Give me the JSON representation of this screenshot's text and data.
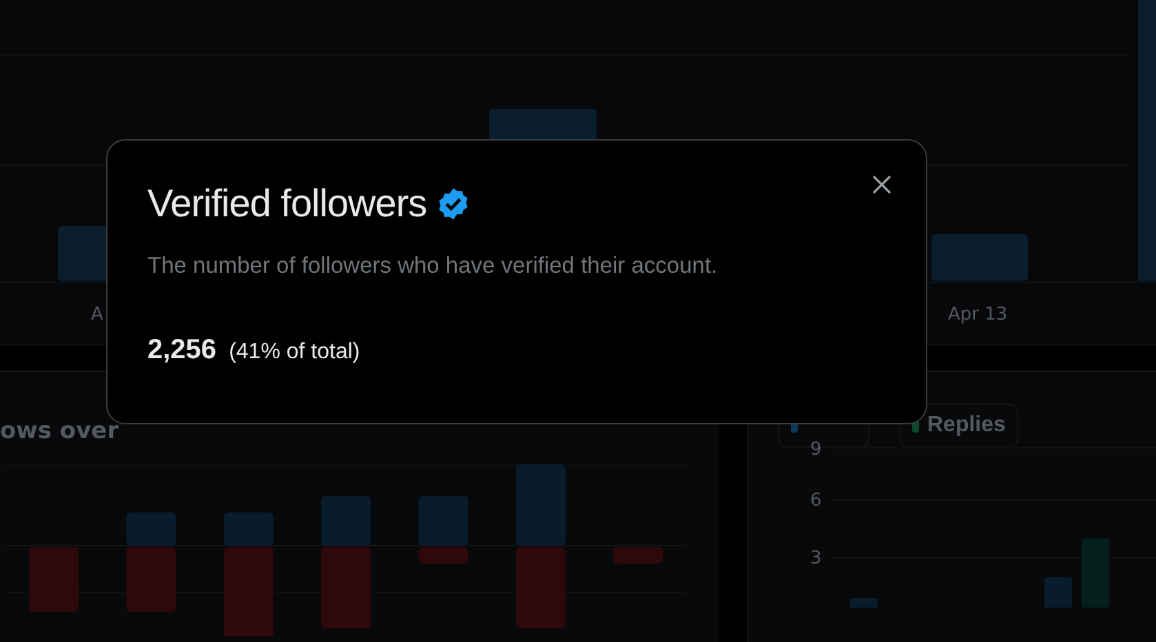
{
  "background": {
    "top_chart_labels": [
      "A",
      "Apr 13"
    ],
    "left_card_title": "ows over",
    "legend": [
      {
        "color": "#0b3a5c"
      },
      {
        "label": "Replies",
        "color": "#0b4a2e"
      }
    ],
    "y_ticks": [
      "9",
      "6",
      "3"
    ]
  },
  "dialog": {
    "title": "Verified followers",
    "verified": true,
    "description": "The number of followers who have verified their account.",
    "value": "2,256",
    "share": "(41% of total)"
  }
}
